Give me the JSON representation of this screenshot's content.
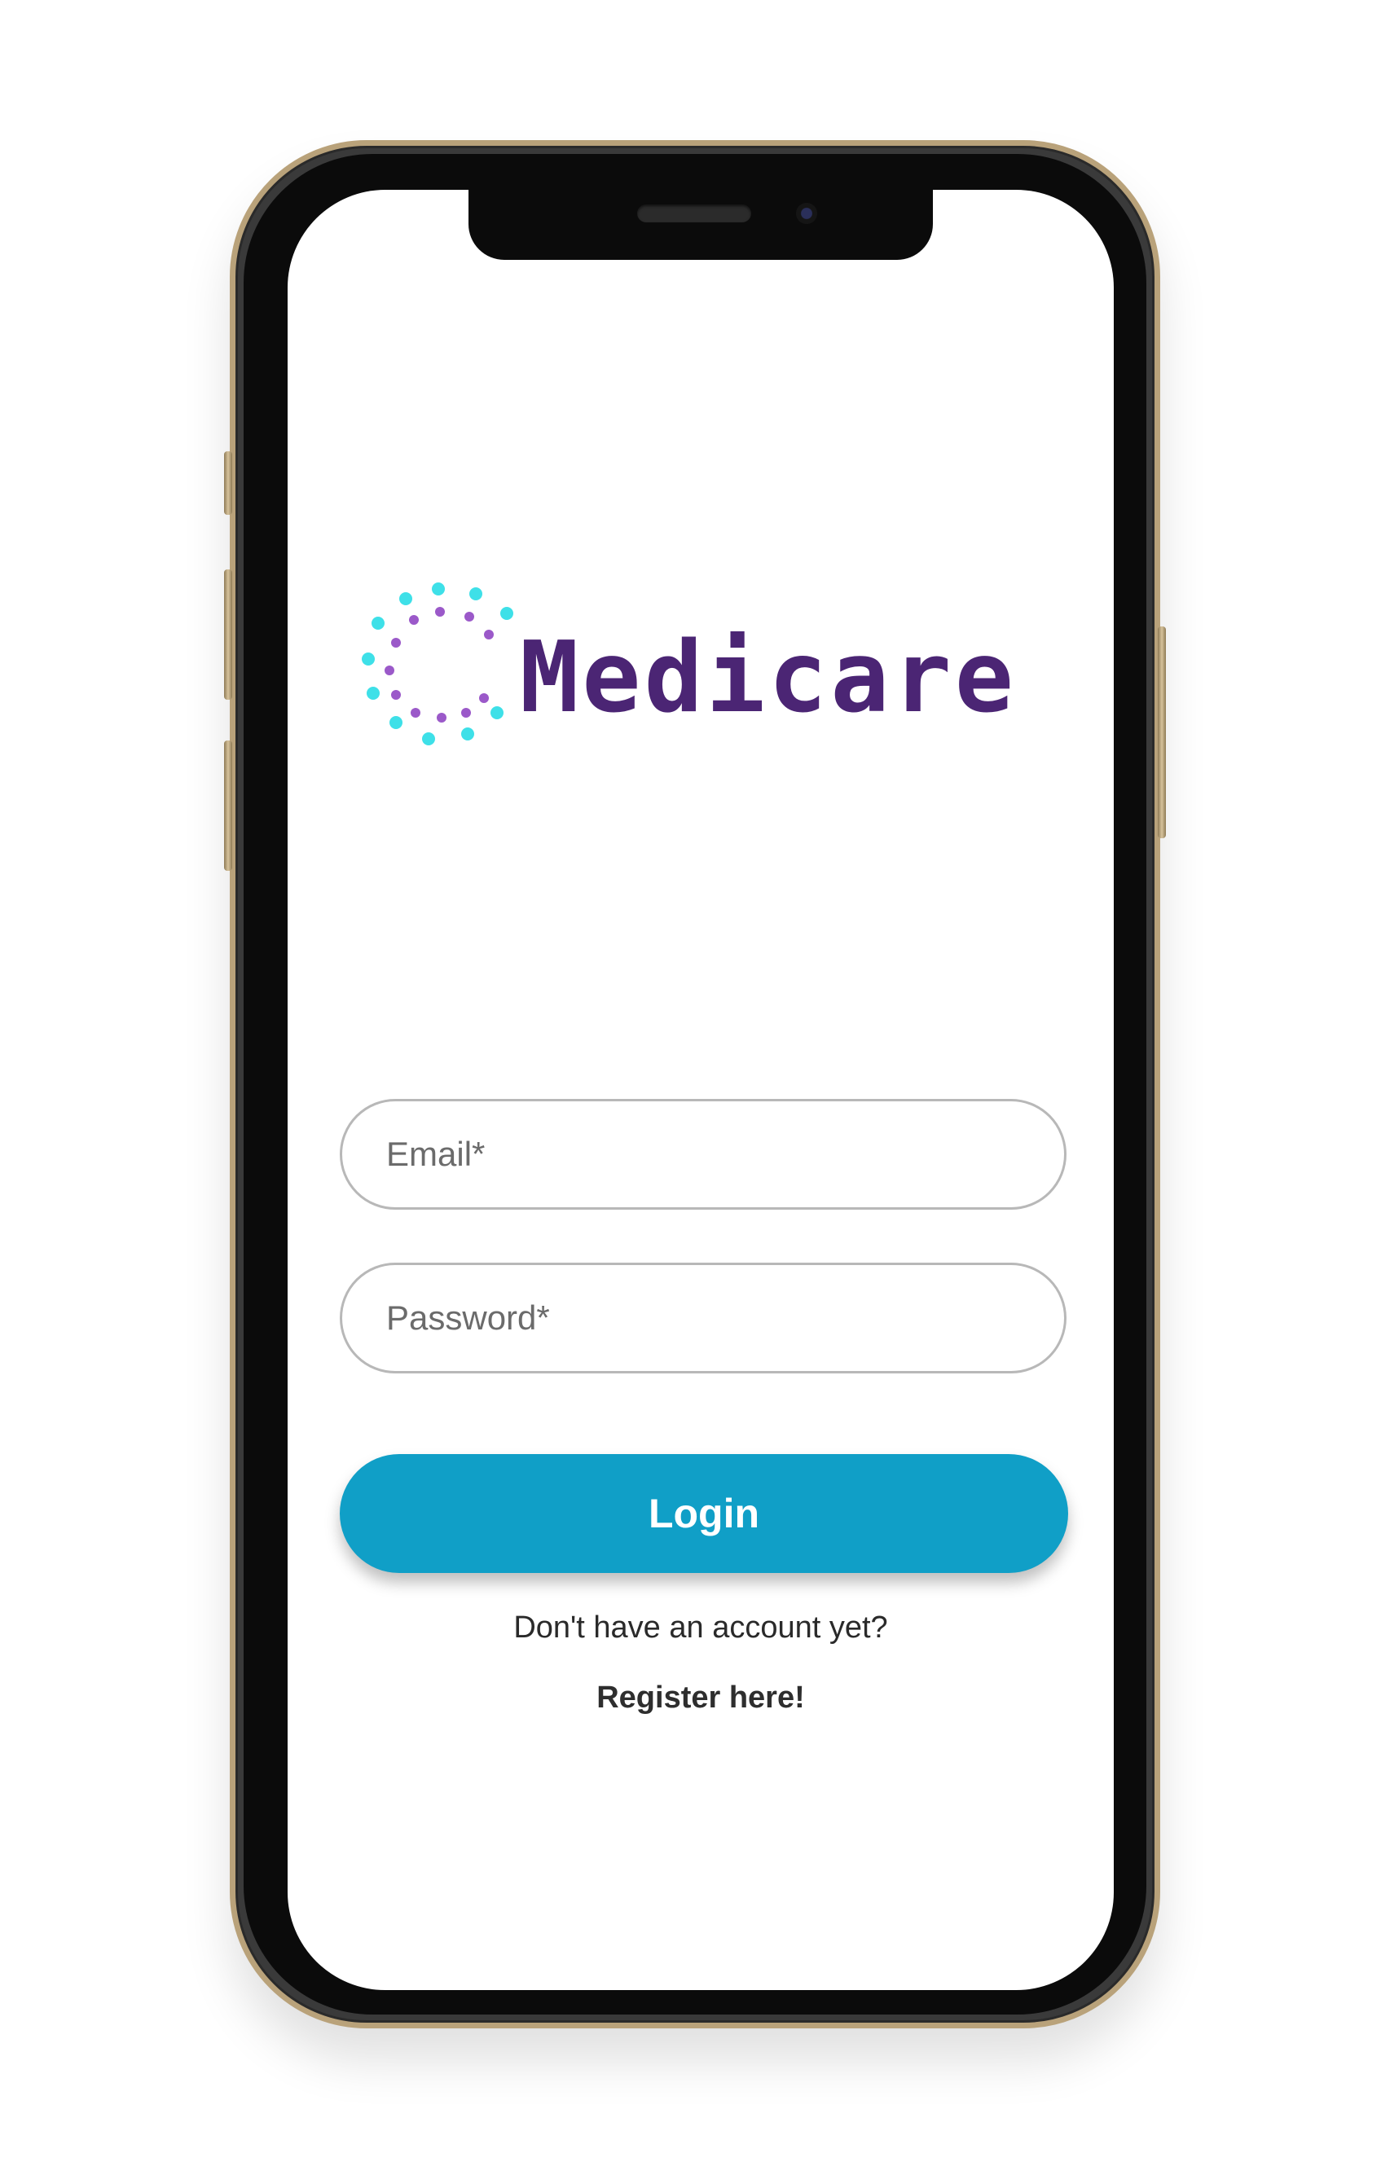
{
  "app": {
    "brand_name": "Medicare",
    "brand_color": "#4b2574",
    "logo_dot_colors": [
      "#3ee0e8",
      "#9b59c9"
    ]
  },
  "login_form": {
    "email_placeholder": "Email*",
    "email_value": "",
    "password_placeholder": "Password*",
    "password_value": "",
    "login_label": "Login",
    "login_color": "#109fc7",
    "no_account_text": "Don't have an account yet?",
    "register_label": "Register here!"
  }
}
